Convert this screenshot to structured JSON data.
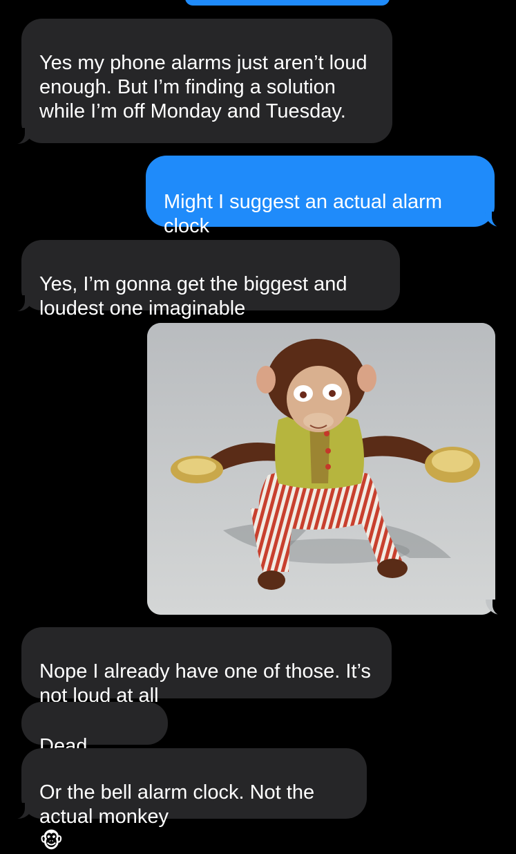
{
  "messages": [
    {
      "from": "them",
      "text": "Yes my phone alarms just aren’t loud enough. But I’m finding a solution while I’m off Monday and Tuesday."
    },
    {
      "from": "me",
      "text": "Might I suggest an actual alarm clock"
    },
    {
      "from": "them",
      "text": "Yes, I’m gonna get the biggest and loudest one imaginable"
    },
    {
      "from": "me",
      "type": "image",
      "image": "cymbal-monkey-toy"
    },
    {
      "from": "them",
      "text": "Nope I already have one of those. It’s not loud at all"
    },
    {
      "from": "them",
      "text": "Dead serious"
    },
    {
      "from": "them",
      "text": "Or the bell alarm clock. Not the actual monkey",
      "emoji": "🐵"
    }
  ],
  "colors": {
    "background": "#000000",
    "incoming_bubble": "#262628",
    "outgoing_bubble": "#1f8bfa",
    "text": "#ffffff"
  }
}
